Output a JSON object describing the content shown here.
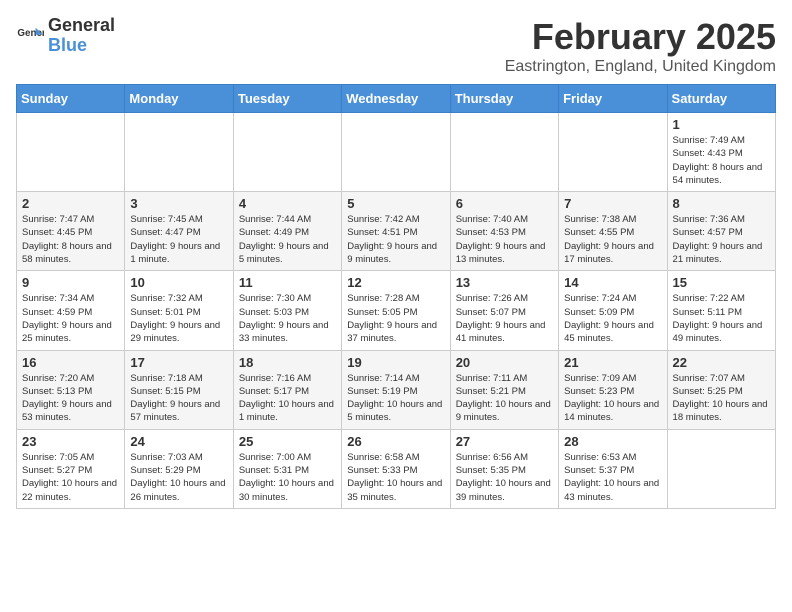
{
  "logo": {
    "general": "General",
    "blue": "Blue"
  },
  "title": "February 2025",
  "location": "Eastrington, England, United Kingdom",
  "days_of_week": [
    "Sunday",
    "Monday",
    "Tuesday",
    "Wednesday",
    "Thursday",
    "Friday",
    "Saturday"
  ],
  "weeks": [
    [
      {
        "day": "",
        "info": ""
      },
      {
        "day": "",
        "info": ""
      },
      {
        "day": "",
        "info": ""
      },
      {
        "day": "",
        "info": ""
      },
      {
        "day": "",
        "info": ""
      },
      {
        "day": "",
        "info": ""
      },
      {
        "day": "1",
        "info": "Sunrise: 7:49 AM\nSunset: 4:43 PM\nDaylight: 8 hours and 54 minutes."
      }
    ],
    [
      {
        "day": "2",
        "info": "Sunrise: 7:47 AM\nSunset: 4:45 PM\nDaylight: 8 hours and 58 minutes."
      },
      {
        "day": "3",
        "info": "Sunrise: 7:45 AM\nSunset: 4:47 PM\nDaylight: 9 hours and 1 minute."
      },
      {
        "day": "4",
        "info": "Sunrise: 7:44 AM\nSunset: 4:49 PM\nDaylight: 9 hours and 5 minutes."
      },
      {
        "day": "5",
        "info": "Sunrise: 7:42 AM\nSunset: 4:51 PM\nDaylight: 9 hours and 9 minutes."
      },
      {
        "day": "6",
        "info": "Sunrise: 7:40 AM\nSunset: 4:53 PM\nDaylight: 9 hours and 13 minutes."
      },
      {
        "day": "7",
        "info": "Sunrise: 7:38 AM\nSunset: 4:55 PM\nDaylight: 9 hours and 17 minutes."
      },
      {
        "day": "8",
        "info": "Sunrise: 7:36 AM\nSunset: 4:57 PM\nDaylight: 9 hours and 21 minutes."
      }
    ],
    [
      {
        "day": "9",
        "info": "Sunrise: 7:34 AM\nSunset: 4:59 PM\nDaylight: 9 hours and 25 minutes."
      },
      {
        "day": "10",
        "info": "Sunrise: 7:32 AM\nSunset: 5:01 PM\nDaylight: 9 hours and 29 minutes."
      },
      {
        "day": "11",
        "info": "Sunrise: 7:30 AM\nSunset: 5:03 PM\nDaylight: 9 hours and 33 minutes."
      },
      {
        "day": "12",
        "info": "Sunrise: 7:28 AM\nSunset: 5:05 PM\nDaylight: 9 hours and 37 minutes."
      },
      {
        "day": "13",
        "info": "Sunrise: 7:26 AM\nSunset: 5:07 PM\nDaylight: 9 hours and 41 minutes."
      },
      {
        "day": "14",
        "info": "Sunrise: 7:24 AM\nSunset: 5:09 PM\nDaylight: 9 hours and 45 minutes."
      },
      {
        "day": "15",
        "info": "Sunrise: 7:22 AM\nSunset: 5:11 PM\nDaylight: 9 hours and 49 minutes."
      }
    ],
    [
      {
        "day": "16",
        "info": "Sunrise: 7:20 AM\nSunset: 5:13 PM\nDaylight: 9 hours and 53 minutes."
      },
      {
        "day": "17",
        "info": "Sunrise: 7:18 AM\nSunset: 5:15 PM\nDaylight: 9 hours and 57 minutes."
      },
      {
        "day": "18",
        "info": "Sunrise: 7:16 AM\nSunset: 5:17 PM\nDaylight: 10 hours and 1 minute."
      },
      {
        "day": "19",
        "info": "Sunrise: 7:14 AM\nSunset: 5:19 PM\nDaylight: 10 hours and 5 minutes."
      },
      {
        "day": "20",
        "info": "Sunrise: 7:11 AM\nSunset: 5:21 PM\nDaylight: 10 hours and 9 minutes."
      },
      {
        "day": "21",
        "info": "Sunrise: 7:09 AM\nSunset: 5:23 PM\nDaylight: 10 hours and 14 minutes."
      },
      {
        "day": "22",
        "info": "Sunrise: 7:07 AM\nSunset: 5:25 PM\nDaylight: 10 hours and 18 minutes."
      }
    ],
    [
      {
        "day": "23",
        "info": "Sunrise: 7:05 AM\nSunset: 5:27 PM\nDaylight: 10 hours and 22 minutes."
      },
      {
        "day": "24",
        "info": "Sunrise: 7:03 AM\nSunset: 5:29 PM\nDaylight: 10 hours and 26 minutes."
      },
      {
        "day": "25",
        "info": "Sunrise: 7:00 AM\nSunset: 5:31 PM\nDaylight: 10 hours and 30 minutes."
      },
      {
        "day": "26",
        "info": "Sunrise: 6:58 AM\nSunset: 5:33 PM\nDaylight: 10 hours and 35 minutes."
      },
      {
        "day": "27",
        "info": "Sunrise: 6:56 AM\nSunset: 5:35 PM\nDaylight: 10 hours and 39 minutes."
      },
      {
        "day": "28",
        "info": "Sunrise: 6:53 AM\nSunset: 5:37 PM\nDaylight: 10 hours and 43 minutes."
      },
      {
        "day": "",
        "info": ""
      }
    ]
  ]
}
